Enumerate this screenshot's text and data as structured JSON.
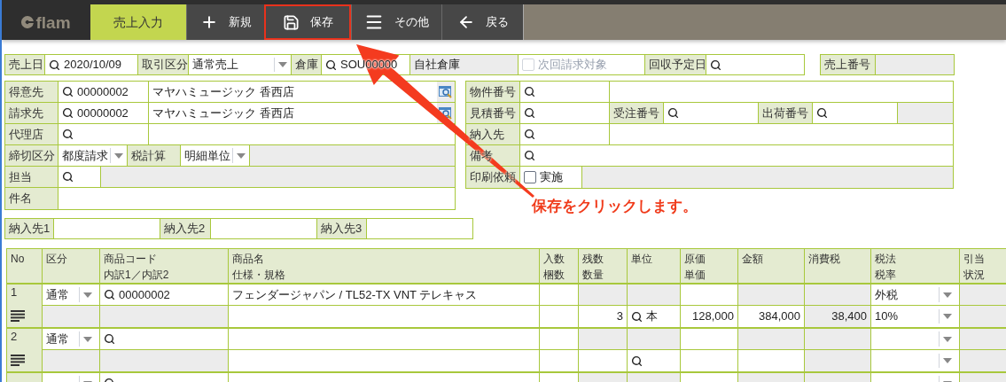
{
  "nav": {
    "logo": "flam",
    "tabs": [
      {
        "label": "売上入力",
        "selected": true
      }
    ],
    "buttons": [
      {
        "kind": "new",
        "label": "新規",
        "highlighted": false
      },
      {
        "kind": "save",
        "label": "保存",
        "highlighted": true
      },
      {
        "kind": "more",
        "label": "その他",
        "highlighted": false
      },
      {
        "kind": "back",
        "label": "戻る",
        "highlighted": false
      }
    ]
  },
  "header_row": [
    {
      "kind": "label",
      "text": "売上日"
    },
    {
      "kind": "search",
      "value": "2020/10/09"
    },
    {
      "kind": "label",
      "text": "取引区分"
    },
    {
      "kind": "select",
      "value": "通常売上"
    },
    {
      "kind": "label",
      "text": "倉庫"
    },
    {
      "kind": "search",
      "value": "SOU00000"
    },
    {
      "kind": "readonly",
      "value": "自社倉庫"
    },
    {
      "kind": "checkbox",
      "text": "次回請求対象",
      "checked": false,
      "disabled": true
    },
    {
      "kind": "label",
      "text": "回収予定日"
    },
    {
      "kind": "search"
    }
  ],
  "sales_number": [
    {
      "kind": "label",
      "text": "売上番号"
    },
    {
      "kind": "readonly"
    }
  ],
  "customer_block": [
    [
      {
        "kind": "label",
        "text": "得意先"
      },
      {
        "kind": "search",
        "value": "00000002"
      },
      {
        "kind": "lookup",
        "value": "マヤハミュージック 香西店"
      }
    ],
    [
      {
        "kind": "label",
        "text": "請求先"
      },
      {
        "kind": "search",
        "value": "00000002"
      },
      {
        "kind": "lookup",
        "value": "マヤハミュージック 香西店"
      }
    ],
    [
      {
        "kind": "label",
        "text": "代理店"
      },
      {
        "kind": "search"
      },
      {
        "kind": "text"
      }
    ],
    [
      {
        "kind": "label",
        "text": "締切区分"
      },
      {
        "kind": "select",
        "value": "都度請求"
      },
      {
        "kind": "label",
        "text": "税計算"
      },
      {
        "kind": "select",
        "value": "明細単位"
      },
      {
        "kind": "readonly"
      }
    ],
    [
      {
        "kind": "label",
        "text": "担当"
      },
      {
        "kind": "search"
      },
      {
        "kind": "readonly"
      }
    ],
    [
      {
        "kind": "label",
        "text": "件名"
      },
      {
        "kind": "text"
      }
    ]
  ],
  "reference_block": [
    [
      {
        "kind": "label",
        "text": "物件番号"
      },
      {
        "kind": "search"
      },
      {
        "kind": "text"
      }
    ],
    [
      {
        "kind": "label",
        "text": "見積番号"
      },
      {
        "kind": "search"
      },
      {
        "kind": "label",
        "text": "受注番号"
      },
      {
        "kind": "search"
      },
      {
        "kind": "label",
        "text": "出荷番号"
      },
      {
        "kind": "search"
      },
      {
        "kind": "readonly"
      }
    ],
    [
      {
        "kind": "label",
        "text": "納入先"
      },
      {
        "kind": "search"
      },
      {
        "kind": "text"
      }
    ],
    [
      {
        "kind": "label",
        "text": "備考"
      },
      {
        "kind": "search"
      }
    ],
    [
      {
        "kind": "label",
        "text": "印刷依頼"
      },
      {
        "kind": "checkbox",
        "text": "実施",
        "checked": false,
        "disabled": false
      },
      {
        "kind": "readonly"
      }
    ]
  ],
  "delivery_row": [
    {
      "kind": "label",
      "text": "納入先1"
    },
    {
      "kind": "text"
    },
    {
      "kind": "label",
      "text": "納入先2"
    },
    {
      "kind": "text"
    },
    {
      "kind": "label",
      "text": "納入先3"
    },
    {
      "kind": "text"
    }
  ],
  "table": {
    "columns": [
      {
        "lines": [
          "No"
        ]
      },
      {
        "lines": [
          "区分"
        ]
      },
      {
        "lines": [
          "商品コード",
          "内訳1／内訳2"
        ]
      },
      {
        "lines": [
          "商品名",
          "仕様・規格"
        ]
      },
      {
        "lines": [
          "入数",
          "梱数"
        ]
      },
      {
        "lines": [
          "残数",
          "数量"
        ]
      },
      {
        "lines": [
          "単位"
        ]
      },
      {
        "lines": [
          "原価",
          "単価"
        ]
      },
      {
        "lines": [
          "金額"
        ]
      },
      {
        "lines": [
          "消費税"
        ]
      },
      {
        "lines": [
          "税法",
          "税率"
        ]
      },
      {
        "lines": [
          "引当",
          "状況"
        ]
      }
    ],
    "items": [
      {
        "no": "1",
        "category": "通常",
        "code": "00000002",
        "name": "フェンダージャパン / TL52-TX VNT テレキャス",
        "quantity": "3",
        "unit": "本",
        "unit_price": "128,000",
        "amount": "384,000",
        "tax": "38,400",
        "tax_method": "外税",
        "tax_rate": "10%"
      },
      {
        "no": "2",
        "category": "通常"
      }
    ]
  },
  "annotation": {
    "text": "保存をクリックします。"
  }
}
